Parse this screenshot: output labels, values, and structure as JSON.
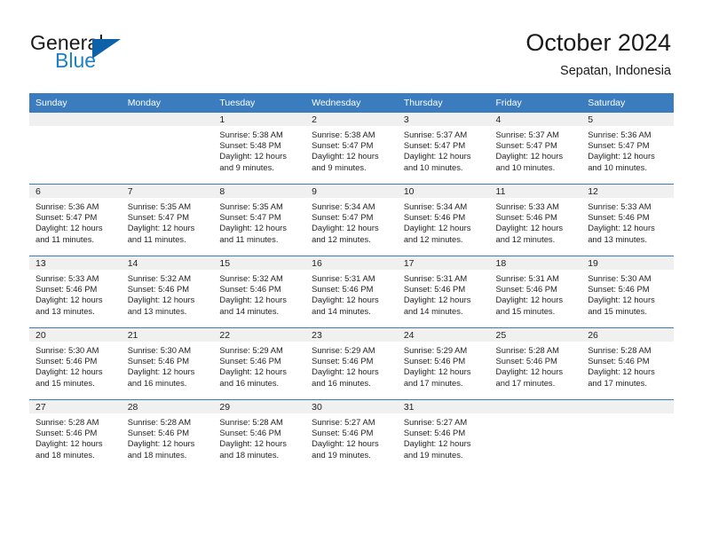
{
  "brand": {
    "name_part1": "General",
    "name_part2": "Blue",
    "triangle_color": "#0d61a8",
    "blue_color": "#1d7fc4"
  },
  "header": {
    "title": "October 2024",
    "subtitle": "Sepatan, Indonesia"
  },
  "theme": {
    "header_row_bg": "#3a7cbe",
    "daynum_band_bg": "#f0f0f0",
    "row_divider": "#3a7cbe",
    "text": "#231f20"
  },
  "weekday_headers": [
    "Sunday",
    "Monday",
    "Tuesday",
    "Wednesday",
    "Thursday",
    "Friday",
    "Saturday"
  ],
  "weeks": [
    [
      {
        "day": "",
        "empty": true,
        "sunrise": "",
        "sunset": "",
        "daylight1": "",
        "daylight2": ""
      },
      {
        "day": "",
        "empty": true,
        "sunrise": "",
        "sunset": "",
        "daylight1": "",
        "daylight2": ""
      },
      {
        "day": "1",
        "empty": false,
        "sunrise": "Sunrise: 5:38 AM",
        "sunset": "Sunset: 5:48 PM",
        "daylight1": "Daylight: 12 hours",
        "daylight2": "and 9 minutes."
      },
      {
        "day": "2",
        "empty": false,
        "sunrise": "Sunrise: 5:38 AM",
        "sunset": "Sunset: 5:47 PM",
        "daylight1": "Daylight: 12 hours",
        "daylight2": "and 9 minutes."
      },
      {
        "day": "3",
        "empty": false,
        "sunrise": "Sunrise: 5:37 AM",
        "sunset": "Sunset: 5:47 PM",
        "daylight1": "Daylight: 12 hours",
        "daylight2": "and 10 minutes."
      },
      {
        "day": "4",
        "empty": false,
        "sunrise": "Sunrise: 5:37 AM",
        "sunset": "Sunset: 5:47 PM",
        "daylight1": "Daylight: 12 hours",
        "daylight2": "and 10 minutes."
      },
      {
        "day": "5",
        "empty": false,
        "sunrise": "Sunrise: 5:36 AM",
        "sunset": "Sunset: 5:47 PM",
        "daylight1": "Daylight: 12 hours",
        "daylight2": "and 10 minutes."
      }
    ],
    [
      {
        "day": "6",
        "empty": false,
        "sunrise": "Sunrise: 5:36 AM",
        "sunset": "Sunset: 5:47 PM",
        "daylight1": "Daylight: 12 hours",
        "daylight2": "and 11 minutes."
      },
      {
        "day": "7",
        "empty": false,
        "sunrise": "Sunrise: 5:35 AM",
        "sunset": "Sunset: 5:47 PM",
        "daylight1": "Daylight: 12 hours",
        "daylight2": "and 11 minutes."
      },
      {
        "day": "8",
        "empty": false,
        "sunrise": "Sunrise: 5:35 AM",
        "sunset": "Sunset: 5:47 PM",
        "daylight1": "Daylight: 12 hours",
        "daylight2": "and 11 minutes."
      },
      {
        "day": "9",
        "empty": false,
        "sunrise": "Sunrise: 5:34 AM",
        "sunset": "Sunset: 5:47 PM",
        "daylight1": "Daylight: 12 hours",
        "daylight2": "and 12 minutes."
      },
      {
        "day": "10",
        "empty": false,
        "sunrise": "Sunrise: 5:34 AM",
        "sunset": "Sunset: 5:46 PM",
        "daylight1": "Daylight: 12 hours",
        "daylight2": "and 12 minutes."
      },
      {
        "day": "11",
        "empty": false,
        "sunrise": "Sunrise: 5:33 AM",
        "sunset": "Sunset: 5:46 PM",
        "daylight1": "Daylight: 12 hours",
        "daylight2": "and 12 minutes."
      },
      {
        "day": "12",
        "empty": false,
        "sunrise": "Sunrise: 5:33 AM",
        "sunset": "Sunset: 5:46 PM",
        "daylight1": "Daylight: 12 hours",
        "daylight2": "and 13 minutes."
      }
    ],
    [
      {
        "day": "13",
        "empty": false,
        "sunrise": "Sunrise: 5:33 AM",
        "sunset": "Sunset: 5:46 PM",
        "daylight1": "Daylight: 12 hours",
        "daylight2": "and 13 minutes."
      },
      {
        "day": "14",
        "empty": false,
        "sunrise": "Sunrise: 5:32 AM",
        "sunset": "Sunset: 5:46 PM",
        "daylight1": "Daylight: 12 hours",
        "daylight2": "and 13 minutes."
      },
      {
        "day": "15",
        "empty": false,
        "sunrise": "Sunrise: 5:32 AM",
        "sunset": "Sunset: 5:46 PM",
        "daylight1": "Daylight: 12 hours",
        "daylight2": "and 14 minutes."
      },
      {
        "day": "16",
        "empty": false,
        "sunrise": "Sunrise: 5:31 AM",
        "sunset": "Sunset: 5:46 PM",
        "daylight1": "Daylight: 12 hours",
        "daylight2": "and 14 minutes."
      },
      {
        "day": "17",
        "empty": false,
        "sunrise": "Sunrise: 5:31 AM",
        "sunset": "Sunset: 5:46 PM",
        "daylight1": "Daylight: 12 hours",
        "daylight2": "and 14 minutes."
      },
      {
        "day": "18",
        "empty": false,
        "sunrise": "Sunrise: 5:31 AM",
        "sunset": "Sunset: 5:46 PM",
        "daylight1": "Daylight: 12 hours",
        "daylight2": "and 15 minutes."
      },
      {
        "day": "19",
        "empty": false,
        "sunrise": "Sunrise: 5:30 AM",
        "sunset": "Sunset: 5:46 PM",
        "daylight1": "Daylight: 12 hours",
        "daylight2": "and 15 minutes."
      }
    ],
    [
      {
        "day": "20",
        "empty": false,
        "sunrise": "Sunrise: 5:30 AM",
        "sunset": "Sunset: 5:46 PM",
        "daylight1": "Daylight: 12 hours",
        "daylight2": "and 15 minutes."
      },
      {
        "day": "21",
        "empty": false,
        "sunrise": "Sunrise: 5:30 AM",
        "sunset": "Sunset: 5:46 PM",
        "daylight1": "Daylight: 12 hours",
        "daylight2": "and 16 minutes."
      },
      {
        "day": "22",
        "empty": false,
        "sunrise": "Sunrise: 5:29 AM",
        "sunset": "Sunset: 5:46 PM",
        "daylight1": "Daylight: 12 hours",
        "daylight2": "and 16 minutes."
      },
      {
        "day": "23",
        "empty": false,
        "sunrise": "Sunrise: 5:29 AM",
        "sunset": "Sunset: 5:46 PM",
        "daylight1": "Daylight: 12 hours",
        "daylight2": "and 16 minutes."
      },
      {
        "day": "24",
        "empty": false,
        "sunrise": "Sunrise: 5:29 AM",
        "sunset": "Sunset: 5:46 PM",
        "daylight1": "Daylight: 12 hours",
        "daylight2": "and 17 minutes."
      },
      {
        "day": "25",
        "empty": false,
        "sunrise": "Sunrise: 5:28 AM",
        "sunset": "Sunset: 5:46 PM",
        "daylight1": "Daylight: 12 hours",
        "daylight2": "and 17 minutes."
      },
      {
        "day": "26",
        "empty": false,
        "sunrise": "Sunrise: 5:28 AM",
        "sunset": "Sunset: 5:46 PM",
        "daylight1": "Daylight: 12 hours",
        "daylight2": "and 17 minutes."
      }
    ],
    [
      {
        "day": "27",
        "empty": false,
        "sunrise": "Sunrise: 5:28 AM",
        "sunset": "Sunset: 5:46 PM",
        "daylight1": "Daylight: 12 hours",
        "daylight2": "and 18 minutes."
      },
      {
        "day": "28",
        "empty": false,
        "sunrise": "Sunrise: 5:28 AM",
        "sunset": "Sunset: 5:46 PM",
        "daylight1": "Daylight: 12 hours",
        "daylight2": "and 18 minutes."
      },
      {
        "day": "29",
        "empty": false,
        "sunrise": "Sunrise: 5:28 AM",
        "sunset": "Sunset: 5:46 PM",
        "daylight1": "Daylight: 12 hours",
        "daylight2": "and 18 minutes."
      },
      {
        "day": "30",
        "empty": false,
        "sunrise": "Sunrise: 5:27 AM",
        "sunset": "Sunset: 5:46 PM",
        "daylight1": "Daylight: 12 hours",
        "daylight2": "and 19 minutes."
      },
      {
        "day": "31",
        "empty": false,
        "sunrise": "Sunrise: 5:27 AM",
        "sunset": "Sunset: 5:46 PM",
        "daylight1": "Daylight: 12 hours",
        "daylight2": "and 19 minutes."
      },
      {
        "day": "",
        "empty": true,
        "sunrise": "",
        "sunset": "",
        "daylight1": "",
        "daylight2": ""
      },
      {
        "day": "",
        "empty": true,
        "sunrise": "",
        "sunset": "",
        "daylight1": "",
        "daylight2": ""
      }
    ]
  ]
}
